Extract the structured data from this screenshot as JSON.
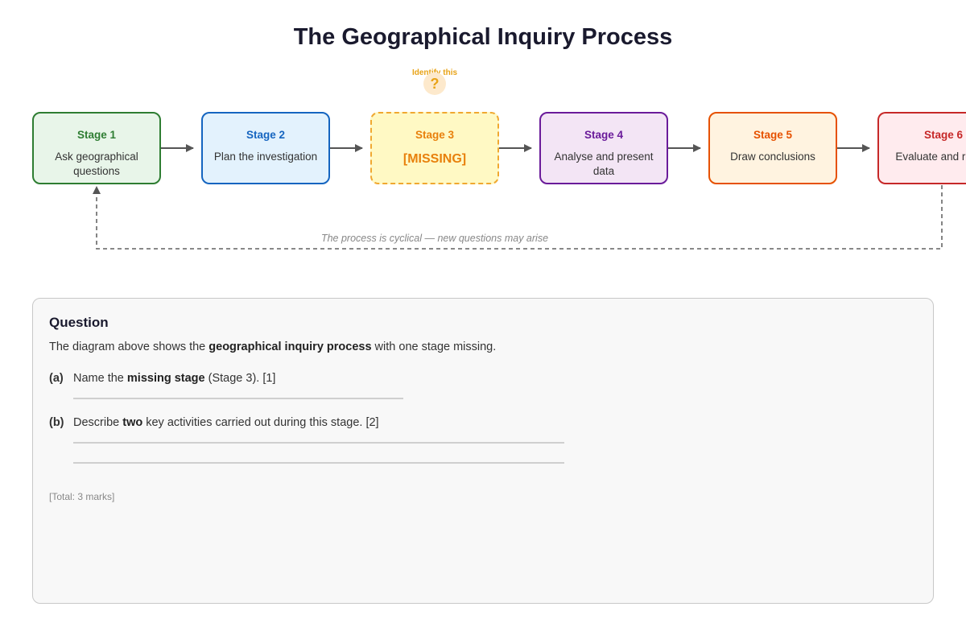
{
  "title": "The Geographical Inquiry Process",
  "hint": {
    "label": "Identify this",
    "mark": "?"
  },
  "stages": [
    {
      "number": "Stage 1",
      "label": "Ask geographical questions",
      "color": "#2e7d32",
      "fill": "#e8f5e9"
    },
    {
      "number": "Stage 2",
      "label": "Plan the investigation",
      "color": "#1565c0",
      "fill": "#e3f2fd"
    },
    {
      "number": "Stage 3",
      "label": "[MISSING]",
      "missing": true,
      "color": "#f0a830",
      "text_color": "#e8800c",
      "fill": "#fff9c4"
    },
    {
      "number": "Stage 4",
      "label": "Analyse and present data",
      "color": "#6a1b9a",
      "fill": "#f3e5f5"
    },
    {
      "number": "Stage 5",
      "label": "Draw conclusions",
      "color": "#e65100",
      "fill": "#fff3e0"
    },
    {
      "number": "Stage 6",
      "label": "Evaluate and reflect",
      "color": "#c62828",
      "fill": "#ffebee"
    }
  ],
  "cycle_caption": "The process is cyclical — new questions may arise",
  "question": {
    "heading": "Question",
    "intro": {
      "before": "The diagram above shows the ",
      "bold": "geographical inquiry process",
      "after": " with one stage missing."
    },
    "parts": [
      {
        "label": "(a)",
        "before": "Name the ",
        "bold": "missing stage",
        "after": " (Stage 3). [1]"
      },
      {
        "label": "(b)",
        "before": "Describe ",
        "bold": "two",
        "after": " key activities carried out during this stage. [2]"
      }
    ],
    "total": "[Total: 3 marks]"
  }
}
